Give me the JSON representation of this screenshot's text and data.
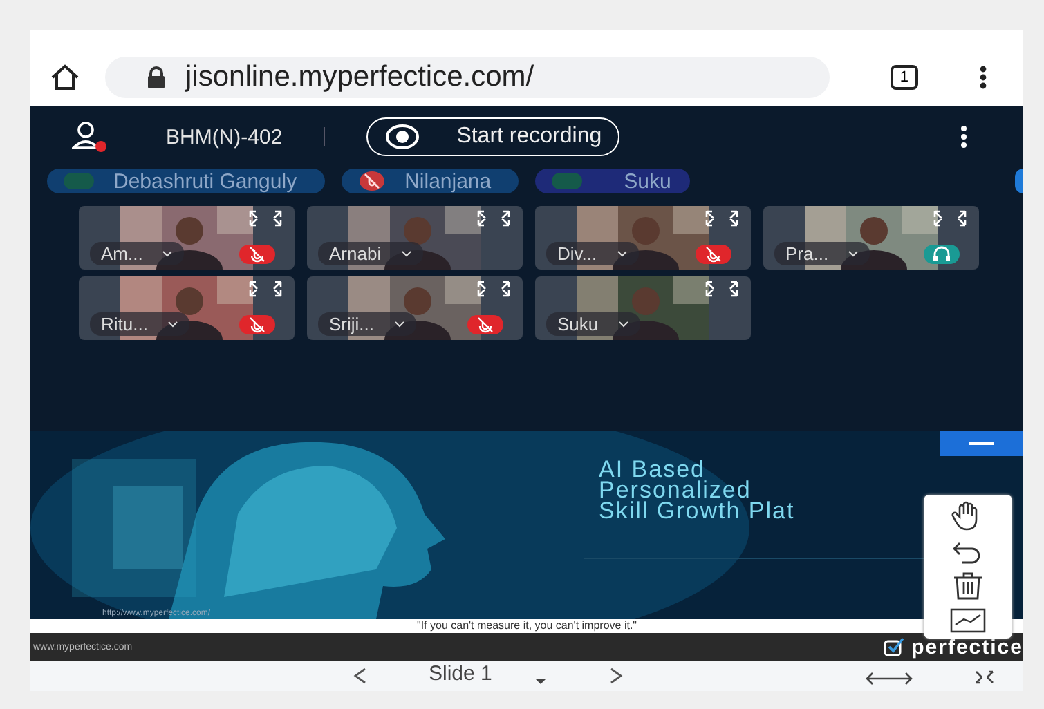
{
  "browser": {
    "url": "jisonline.myperfectice.com/",
    "tab_count": "1"
  },
  "header": {
    "room": "BHM(N)-402",
    "record_label": "Start recording"
  },
  "speakers": [
    {
      "name": "Debashruti Ganguly",
      "kind": "active"
    },
    {
      "name": "Nilanjana",
      "kind": "muted"
    },
    {
      "name": "Suku",
      "kind": "active"
    }
  ],
  "tiles": [
    {
      "name": "Am...",
      "kind": "muted"
    },
    {
      "name": "Arnabi",
      "kind": "plain"
    },
    {
      "name": "Div...",
      "kind": "muted"
    },
    {
      "name": "Pra...",
      "kind": "headset"
    },
    {
      "name": "Ritu...",
      "kind": "muted"
    },
    {
      "name": "Sriji...",
      "kind": "muted"
    },
    {
      "name": "Suku",
      "kind": "plain"
    }
  ],
  "slide": {
    "heading_lines": [
      "AI Based",
      "Personalized",
      "Skill Growth Plat"
    ],
    "source_url": "http://www.myperfectice.com/",
    "quote": "\"If you can't measure it, you can't improve it.\"",
    "footer_url": "www.myperfectice.com",
    "brand": "perfectice"
  },
  "slide_nav": {
    "label": "Slide 1"
  }
}
